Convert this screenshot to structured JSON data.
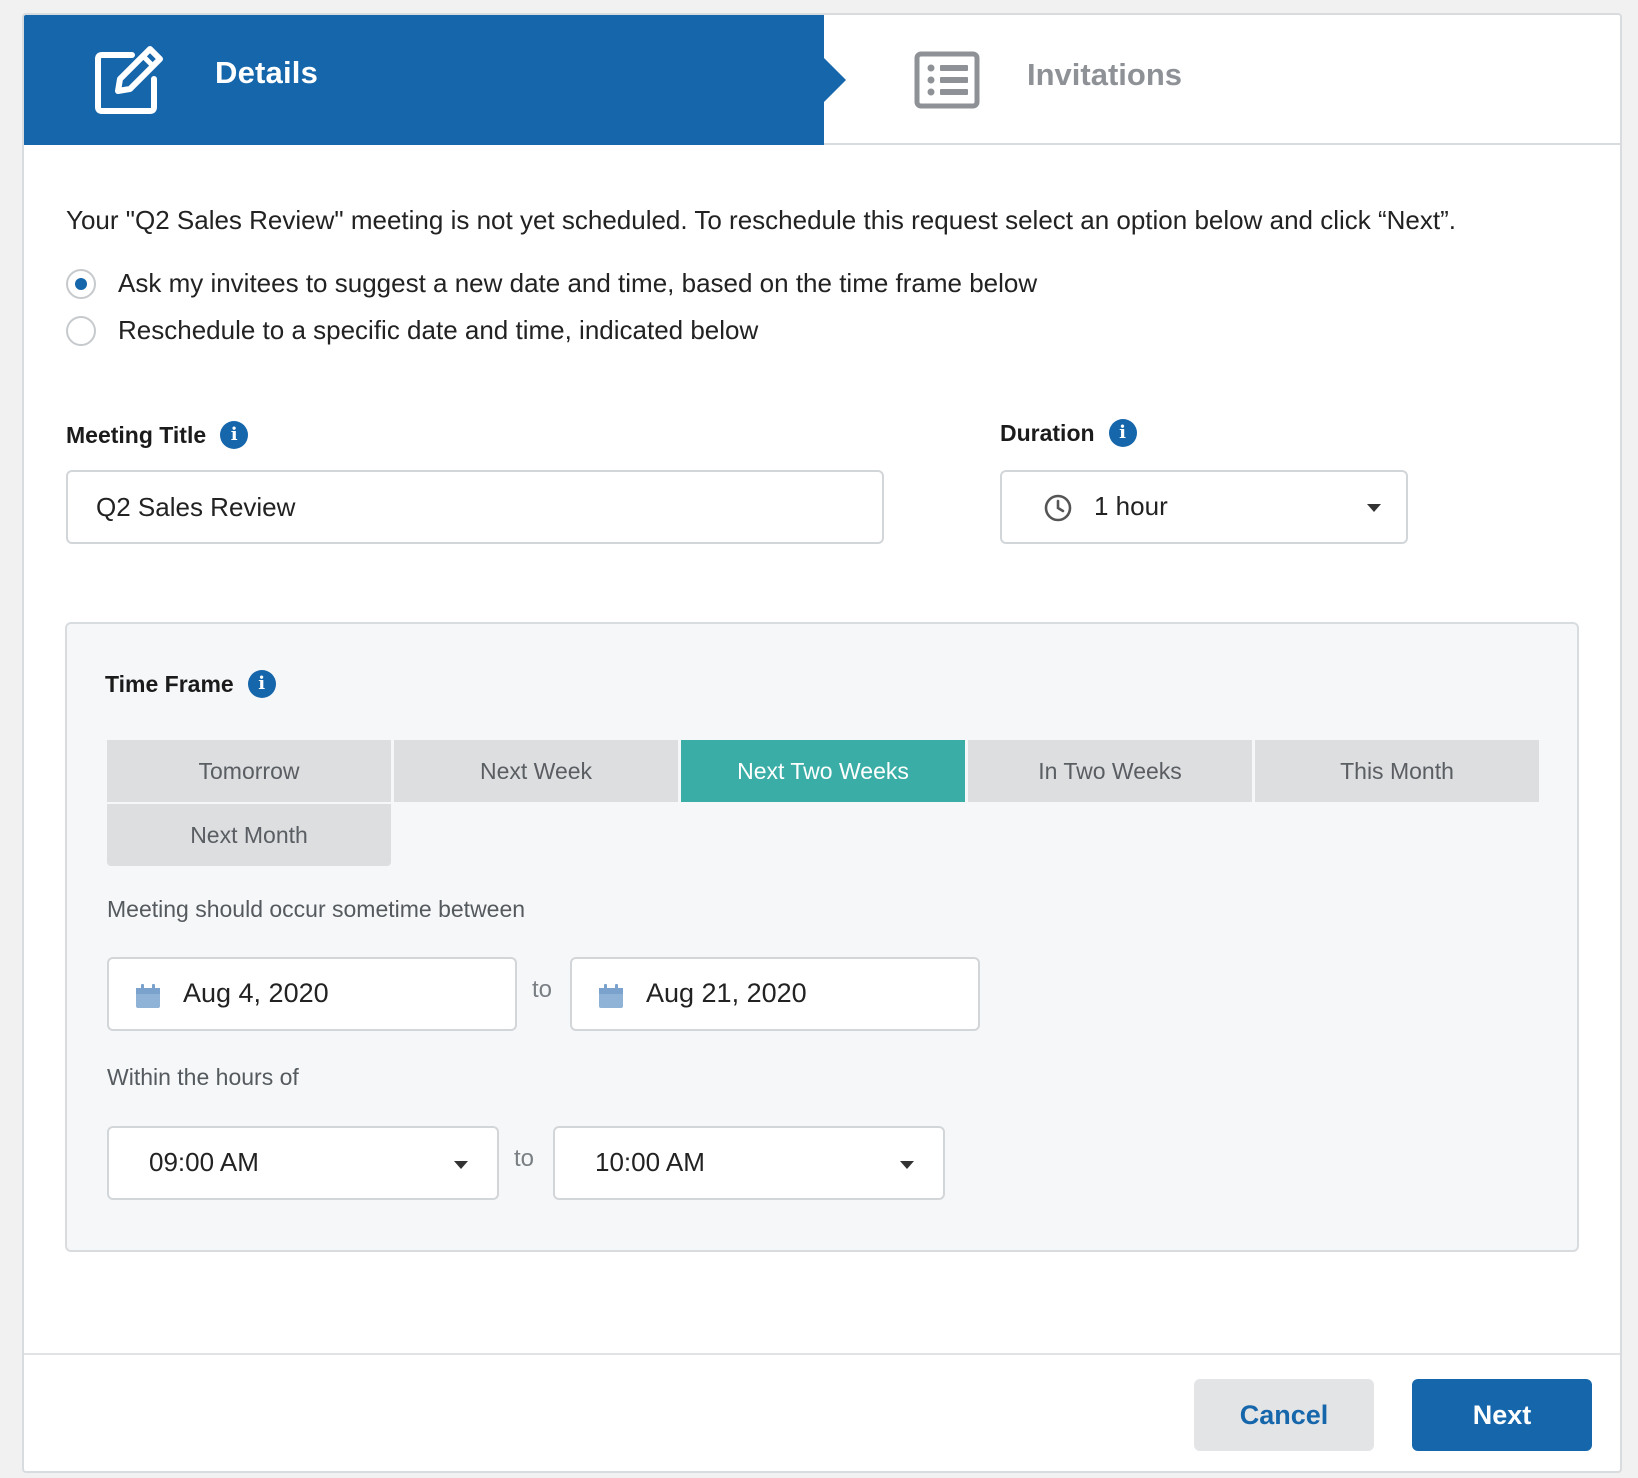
{
  "steps": {
    "details_label": "Details",
    "invitations_label": "Invitations"
  },
  "intro_text": "Your \"Q2 Sales Review\" meeting is not yet scheduled. To reschedule this request select an option below and click “Next”.",
  "options": [
    {
      "label": "Ask my invitees to suggest a new date and time, based on the time frame below",
      "checked": true
    },
    {
      "label": "Reschedule to a specific date and time, indicated below",
      "checked": false
    }
  ],
  "meeting_title": {
    "label": "Meeting Title",
    "value": "Q2 Sales Review"
  },
  "duration": {
    "label": "Duration",
    "value": "1 hour"
  },
  "info_glyph": "i",
  "time_frame": {
    "label": "Time Frame",
    "buttons": [
      "Tomorrow",
      "Next Week",
      "Next Two Weeks",
      "In Two Weeks",
      "This Month",
      "Next Month"
    ],
    "selected": "Next Two Weeks",
    "between_label": "Meeting should occur sometime between",
    "start_date": "Aug 4, 2020",
    "end_date": "Aug 21, 2020",
    "to_text": "to",
    "hours_label": "Within the hours of",
    "start_time": "09:00 AM",
    "end_time": "10:00 AM"
  },
  "footer": {
    "cancel_label": "Cancel",
    "next_label": "Next"
  },
  "colors": {
    "primary": "#1566ab",
    "selected_tab": "#3aaea6",
    "calendar_icon": "#8fb3d6"
  }
}
